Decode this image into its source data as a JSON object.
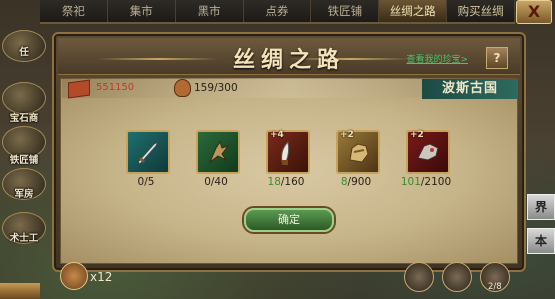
{
  "tabs": [
    "祭祀",
    "集市",
    "黑市",
    "点券",
    "铁匠铺",
    "丝绸之路",
    "购买丝绸"
  ],
  "active_tab": 5,
  "close_label": "X",
  "side_menu": [
    "任",
    "宝石商",
    "铁匠铺",
    "军房",
    "术士工"
  ],
  "right_buttons": [
    "界",
    "本"
  ],
  "panel": {
    "title": "丝绸之路",
    "treasure_link": "查看我的珍宝>",
    "help_label": "?",
    "red_value": "551150",
    "bag_count": "159/300",
    "region": "波斯古国",
    "confirm_label": "确定"
  },
  "items": [
    {
      "name": "dagger-icon",
      "plus": "",
      "have": "0",
      "need": "/5",
      "have_green": false
    },
    {
      "name": "claw-icon",
      "plus": "",
      "have": "0",
      "need": "/40",
      "have_green": false
    },
    {
      "name": "blade-icon",
      "plus": "+4",
      "have": "18",
      "need": "/160",
      "have_green": true
    },
    {
      "name": "gauntlet-icon",
      "plus": "+2",
      "have": "8",
      "need": "/900",
      "have_green": true
    },
    {
      "name": "beast-icon",
      "plus": "+2",
      "have": "101",
      "need": "/2100",
      "have_green": true
    }
  ],
  "bottom": {
    "multiplier": "x12",
    "page": "2/8"
  }
}
